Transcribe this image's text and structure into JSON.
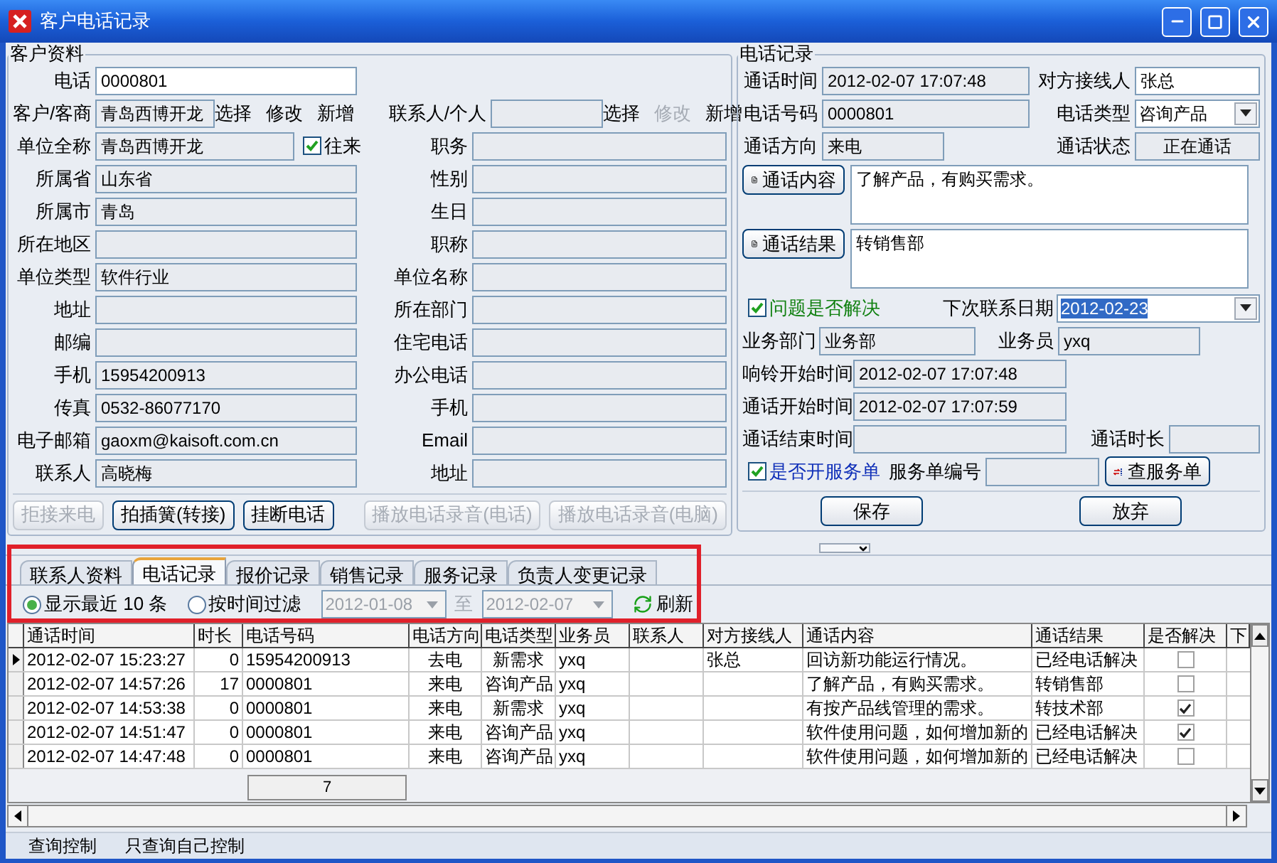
{
  "window": {
    "title": "客户电话记录"
  },
  "customer": {
    "title": "客户资料",
    "phone": {
      "label": "电话",
      "value": "0000801",
      "editable": true
    },
    "company": {
      "label": "客户/客商",
      "value": "青岛西博开龙",
      "editable": false,
      "actions": [
        {
          "label": "选择",
          "disabled": false
        },
        {
          "label": "修改",
          "disabled": false
        },
        {
          "label": "新增",
          "disabled": false
        }
      ]
    },
    "person": {
      "label": "联系人/个人",
      "editable": false,
      "actions": [
        {
          "label": "选择",
          "disabled": false
        },
        {
          "label": "修改",
          "disabled": true
        },
        {
          "label": "新增",
          "disabled": false
        }
      ]
    },
    "full_name": {
      "label": "单位全称",
      "value": "青岛西博开龙",
      "editable": false
    },
    "dealing": {
      "label": "往来",
      "checked": true
    },
    "position": {
      "label": "职务",
      "editable": false
    },
    "rows": [
      {
        "left": {
          "label": "所属省",
          "value": "山东省",
          "editable": false
        },
        "right": {
          "label": "性别",
          "editable": false
        }
      },
      {
        "left": {
          "label": "所属市",
          "value": "青岛",
          "editable": false
        },
        "right": {
          "label": "生日",
          "editable": false
        }
      },
      {
        "left": {
          "label": "所在地区",
          "editable": false
        },
        "right": {
          "label": "职称",
          "editable": false
        }
      },
      {
        "left": {
          "label": "单位类型",
          "value": "软件行业",
          "editable": false
        },
        "right": {
          "label": "单位名称",
          "editable": false
        }
      },
      {
        "left": {
          "label": "地址",
          "editable": false
        },
        "right": {
          "label": "所在部门",
          "editable": false
        }
      },
      {
        "left": {
          "label": "邮编",
          "editable": false
        },
        "right": {
          "label": "住宅电话",
          "editable": false
        }
      },
      {
        "left": {
          "label": "手机",
          "value": "15954200913",
          "editable": false
        },
        "right": {
          "label": "办公电话",
          "editable": false
        }
      },
      {
        "left": {
          "label": "传真",
          "value": "0532-86077170",
          "editable": false
        },
        "right": {
          "label": "手机",
          "editable": false
        }
      },
      {
        "left": {
          "label": "电子邮箱",
          "value": "gaoxm@kaisoft.com.cn",
          "editable": false
        },
        "right": {
          "label": "Email",
          "editable": false
        }
      },
      {
        "left": {
          "label": "联系人",
          "value": "高晓梅",
          "editable": false
        },
        "right": {
          "label": "地址",
          "editable": false
        }
      }
    ],
    "buttons": [
      {
        "label": "拒接来电",
        "disabled": true
      },
      {
        "label": "拍插簧(转接)",
        "disabled": false
      },
      {
        "label": "挂断电话",
        "disabled": false
      },
      {
        "label": "播放电话录音(电话)",
        "disabled": true
      },
      {
        "label": "播放电话录音(电脑)",
        "disabled": true
      }
    ]
  },
  "call": {
    "title": "电话记录",
    "call_time": {
      "label": "通话时间",
      "value": "2012-02-07 17:07:48",
      "editable": false
    },
    "receiver": {
      "label": "对方接线人",
      "value": "张总",
      "editable": true
    },
    "number": {
      "label": "电话号码",
      "value": "0000801",
      "editable": false
    },
    "call_type": {
      "label": "电话类型",
      "value": "咨询产品"
    },
    "direction": {
      "label": "通话方向",
      "value": "来电",
      "editable": false
    },
    "status": {
      "label": "通话状态",
      "value": "正在通话",
      "editable": false
    },
    "content": {
      "button": "通话内容",
      "value": "了解产品，有购买需求。"
    },
    "result": {
      "button": "通话结果",
      "value": "转销售部"
    },
    "resolved": {
      "label": "问题是否解决",
      "checked": true
    },
    "next_date": {
      "label": "下次联系日期",
      "value": "2012-02-23"
    },
    "department": {
      "label": "业务部门",
      "value": "业务部",
      "editable": false
    },
    "salesman": {
      "label": "业务员",
      "value": "yxq",
      "editable": false
    },
    "ring_start": {
      "label": "响铃开始时间",
      "value": "2012-02-07 17:07:48",
      "editable": false
    },
    "talk_start": {
      "label": "通话开始时间",
      "value": "2012-02-07 17:07:59",
      "editable": false
    },
    "talk_end": {
      "label": "通话结束时间",
      "editable": false
    },
    "duration": {
      "label": "通话时长",
      "editable": false
    },
    "service_order": {
      "label": "是否开服务单",
      "checked": true
    },
    "order_no": {
      "label": "服务单编号",
      "editable": false
    },
    "query_button": "查服务单",
    "buttons": [
      "保存",
      "放弃"
    ]
  },
  "tabs": [
    {
      "label": "联系人资料",
      "selected": false
    },
    {
      "label": "电话记录",
      "selected": true
    },
    {
      "label": "报价记录",
      "selected": false
    },
    {
      "label": "销售记录",
      "selected": false
    },
    {
      "label": "服务记录",
      "selected": false
    },
    {
      "label": "负责人变更记录",
      "selected": false
    }
  ],
  "filter": {
    "options": [
      {
        "label": "显示最近 10 条",
        "selected": true
      },
      {
        "label": "按时间过滤",
        "selected": false
      }
    ],
    "from": {
      "value": "2012-01-08",
      "disabled": true
    },
    "to_label": "至",
    "to": {
      "value": "2012-02-07",
      "disabled": true
    },
    "refresh": "刷新"
  },
  "table": {
    "columns": [
      "通话时间",
      "时长",
      "电话号码",
      "电话方向",
      "电话类型",
      "业务员",
      "联系人",
      "对方接线人",
      "通话内容",
      "通话结果",
      "是否解决",
      "下"
    ],
    "rows": [
      {
        "current": true,
        "cells": [
          "2012-02-07 15:23:27",
          "0",
          "15954200913",
          "去电",
          "新需求",
          "yxq",
          "",
          "张总",
          "回访新功能运行情况。",
          "已经电话解决"
        ],
        "resolved": false
      },
      {
        "current": false,
        "cells": [
          "2012-02-07 14:57:26",
          "17",
          "0000801",
          "来电",
          "咨询产品",
          "yxq",
          "",
          "",
          "了解产品，有购买需求。",
          "转销售部"
        ],
        "resolved": false
      },
      {
        "current": false,
        "cells": [
          "2012-02-07 14:53:38",
          "0",
          "0000801",
          "来电",
          "新需求",
          "yxq",
          "",
          "",
          "有按产品线管理的需求。",
          "转技术部"
        ],
        "resolved": true
      },
      {
        "current": false,
        "cells": [
          "2012-02-07 14:51:47",
          "0",
          "0000801",
          "来电",
          "咨询产品",
          "yxq",
          "",
          "",
          "软件使用问题，如何增加新的",
          "已经电话解决"
        ],
        "resolved": true
      },
      {
        "current": false,
        "cells": [
          "2012-02-07 14:47:48",
          "0",
          "0000801",
          "来电",
          "咨询产品",
          "yxq",
          "",
          "",
          "软件使用问题，如何增加新的",
          "已经电话解决"
        ],
        "resolved": false
      }
    ],
    "footer_count": "7"
  },
  "status_bar": [
    "查询控制",
    "只查询自己控制"
  ]
}
